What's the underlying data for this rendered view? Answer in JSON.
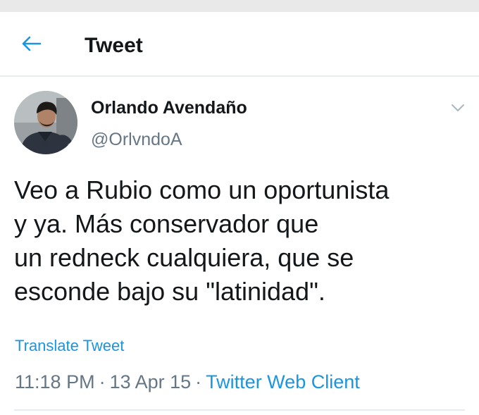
{
  "header": {
    "title": "Tweet",
    "back_icon": "arrow-left-icon"
  },
  "tweet": {
    "author": {
      "display_name": "Orlando Avendaño",
      "handle": "@OrlvndoA"
    },
    "text_lines": [
      "Veo a Rubio como un oportunista",
      "y ya. Más conservador que",
      "un redneck cualquiera, que se",
      "esconde bajo su \"latinidad\"."
    ],
    "translate_label": "Translate Tweet",
    "time": "11:18 PM",
    "date": "13 Apr 15",
    "separator": "·",
    "client": "Twitter Web Client"
  },
  "colors": {
    "accent": "#1b95e0",
    "muted": "#657786",
    "text": "#14171a",
    "divider": "#e6ecf0"
  }
}
